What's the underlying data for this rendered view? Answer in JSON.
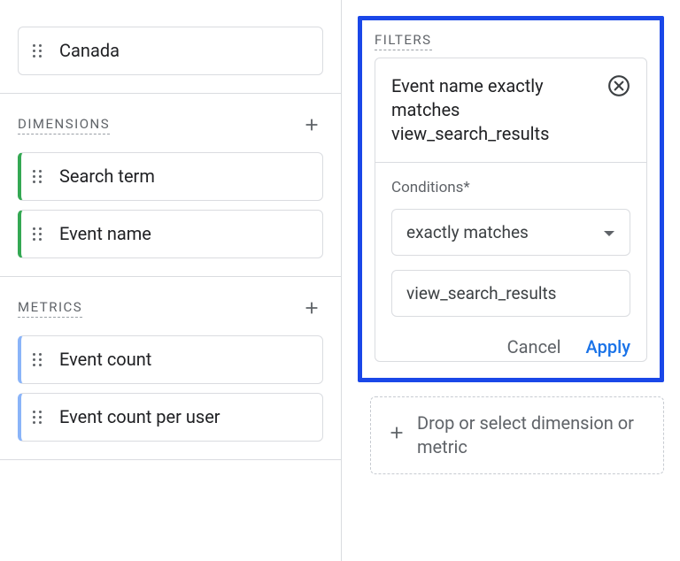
{
  "left": {
    "top_items": [
      "Canada"
    ],
    "dimensions": {
      "label": "DIMENSIONS",
      "items": [
        "Search term",
        "Event name"
      ]
    },
    "metrics": {
      "label": "METRICS",
      "items": [
        "Event count",
        "Event count per user"
      ]
    }
  },
  "filters": {
    "title": "FILTERS",
    "summary": "Event name exactly matches view_search_results",
    "conditions_label": "Conditions*",
    "match_type": "exactly matches",
    "value": "view_search_results",
    "cancel": "Cancel",
    "apply": "Apply"
  },
  "dropzone": {
    "text": "Drop or select dimension or metric"
  }
}
